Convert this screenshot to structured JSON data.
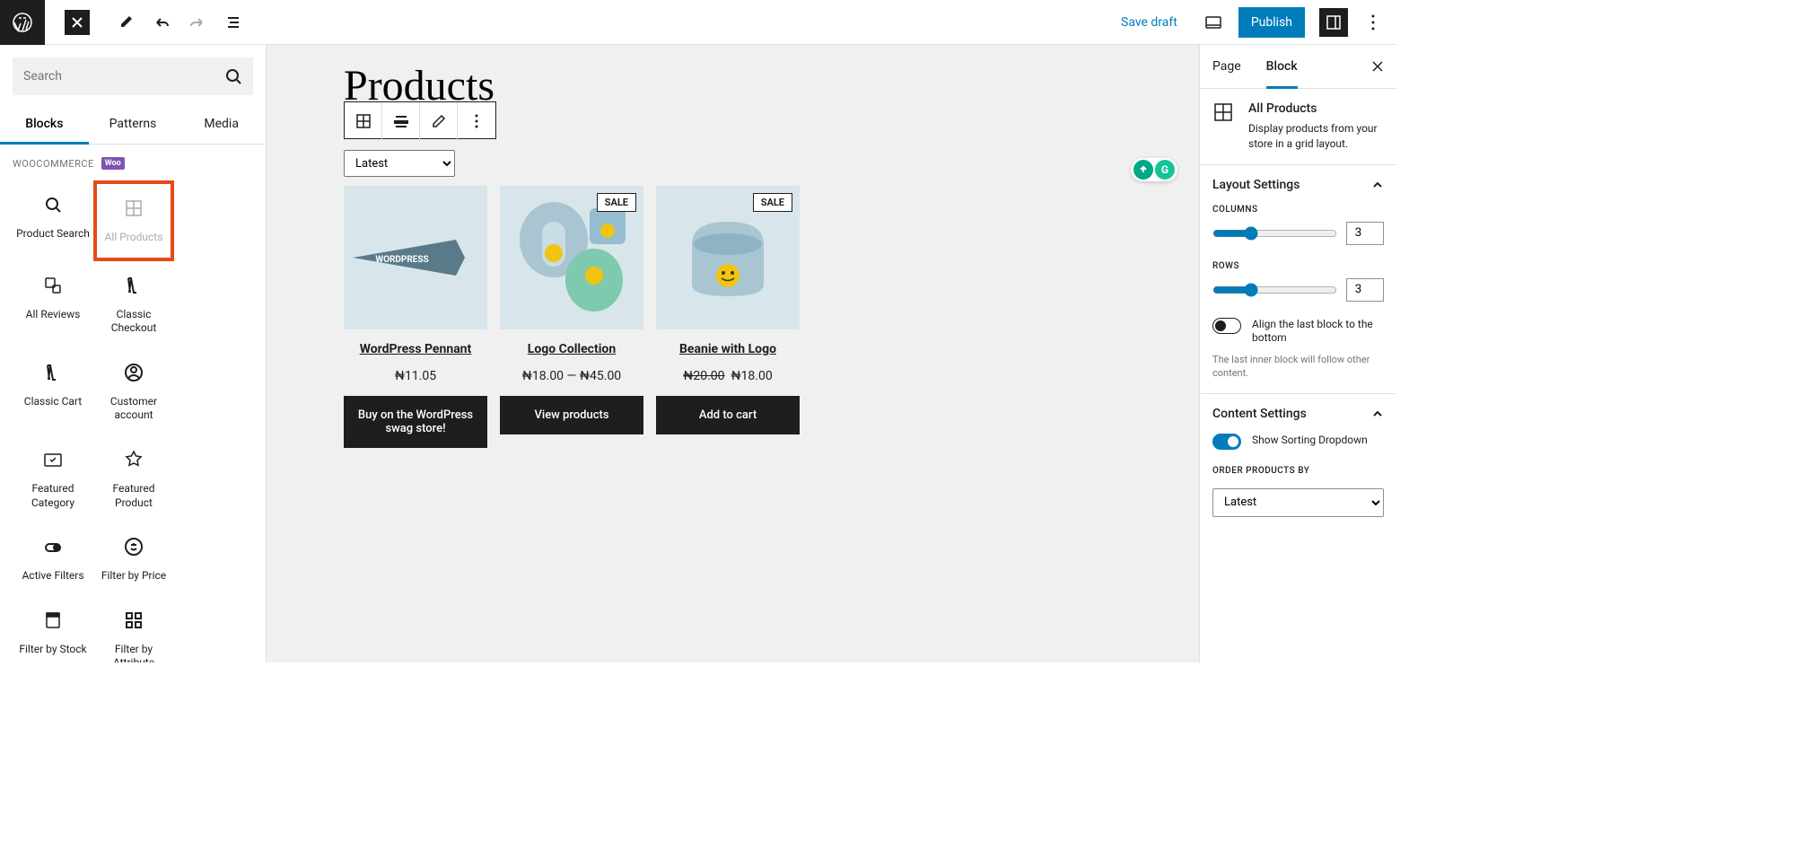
{
  "topbar": {
    "save_draft": "Save draft",
    "publish": "Publish"
  },
  "inserter": {
    "search_placeholder": "Search",
    "tabs": {
      "blocks": "Blocks",
      "patterns": "Patterns",
      "media": "Media"
    },
    "category": "WOOCOMMERCE",
    "category_badge": "Woo",
    "blocks": [
      {
        "label": "Product Search"
      },
      {
        "label": "All Products"
      },
      {
        "label": "All Reviews"
      },
      {
        "label": "Classic Checkout"
      },
      {
        "label": "Classic Cart"
      },
      {
        "label": "Customer account"
      },
      {
        "label": "Featured Category"
      },
      {
        "label": "Featured Product"
      },
      {
        "label": "Active Filters"
      },
      {
        "label": "Filter by Price"
      },
      {
        "label": "Filter by Stock"
      },
      {
        "label": "Filter by Attribute"
      }
    ]
  },
  "canvas": {
    "title": "Products",
    "sort_value": "Latest",
    "products": [
      {
        "name": "WordPress Pennant",
        "price": "₦11.05",
        "button": "Buy on the WordPress swag store!",
        "sale": false
      },
      {
        "name": "Logo Collection",
        "price": "₦18.00 — ₦45.00",
        "button": "View products",
        "sale": true
      },
      {
        "name": "Beanie with Logo",
        "old_price": "₦20.00",
        "price": "₦18.00",
        "button": "Add to cart",
        "sale": true
      }
    ],
    "sale_label": "SALE",
    "grammarly": "G"
  },
  "settings": {
    "tabs": {
      "page": "Page",
      "block": "Block"
    },
    "block_name": "All Products",
    "block_desc": "Display products from your store in a grid layout.",
    "layout_title": "Layout Settings",
    "columns_label": "COLUMNS",
    "columns_value": 3,
    "rows_label": "ROWS",
    "rows_value": 3,
    "align_label": "Align the last block to the bottom",
    "align_help": "The last inner block will follow other content.",
    "content_title": "Content Settings",
    "sorting_label": "Show Sorting Dropdown",
    "order_label": "ORDER PRODUCTS BY",
    "order_value": "Latest"
  }
}
